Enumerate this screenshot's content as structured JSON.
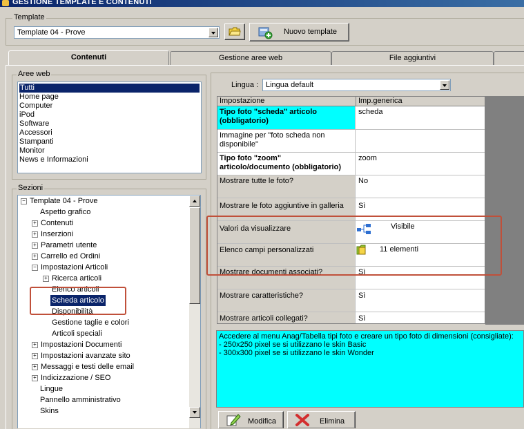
{
  "window": {
    "title": "GESTIONE TEMPLATE E CONTENUTI"
  },
  "template": {
    "group_label": "Template",
    "selected": "Template 04 - Prove",
    "new_button": "Nuovo template"
  },
  "tabs": [
    {
      "label": "Contenuti",
      "active": true
    },
    {
      "label": "Gestione aree web",
      "active": false
    },
    {
      "label": "File aggiuntivi",
      "active": false
    }
  ],
  "aree_web": {
    "label": "Aree web",
    "items": [
      "Tutti",
      "Home page",
      "Computer",
      "iPod",
      "Software",
      "Accessori",
      "Stampanti",
      "Monitor",
      "News e Informazioni"
    ],
    "selected_index": 0
  },
  "sezioni": {
    "label": "Sezioni",
    "nodes": [
      {
        "label": "Template 04 - Prove",
        "expander": "minus"
      },
      {
        "label": "Aspetto grafico",
        "expander": ""
      },
      {
        "label": "Contenuti",
        "expander": "plus"
      },
      {
        "label": "Inserzioni",
        "expander": "plus"
      },
      {
        "label": "Parametri utente",
        "expander": "plus"
      },
      {
        "label": "Carrello ed Ordini",
        "expander": "plus"
      },
      {
        "label": "Impostazioni Articoli",
        "expander": "minus"
      },
      {
        "label": "Ricerca articoli",
        "expander": "plus"
      },
      {
        "label": "Elenco articoli",
        "expander": ""
      },
      {
        "label": "Scheda articolo",
        "expander": ""
      },
      {
        "label": "Disponibilità",
        "expander": ""
      },
      {
        "label": "Gestione taglie e colori",
        "expander": ""
      },
      {
        "label": "Articoli speciali",
        "expander": ""
      },
      {
        "label": "Impostazioni Documenti",
        "expander": "plus"
      },
      {
        "label": "Impostazioni avanzate sito",
        "expander": "plus"
      },
      {
        "label": "Messaggi e testi delle email",
        "expander": "plus"
      },
      {
        "label": "Indicizzazione / SEO",
        "expander": "plus"
      },
      {
        "label": "Lingue",
        "expander": ""
      },
      {
        "label": "Pannello amministrativo",
        "expander": ""
      },
      {
        "label": "Skins",
        "expander": ""
      }
    ],
    "selected": "Scheda articolo"
  },
  "lingua": {
    "label": "Lingua :",
    "selected": "Lingua default"
  },
  "settings": {
    "headers": [
      "Impostazione",
      "Imp.generica"
    ],
    "rows": [
      {
        "name": "Tipo foto \"scheda\" articolo (obbligatorio)",
        "value": "scheda",
        "style": "hl"
      },
      {
        "name": "Immagine per \"foto scheda non disponibile\"",
        "value": "",
        "style": "white"
      },
      {
        "name": "Tipo foto \"zoom\" articolo/documento (obbligatorio)",
        "value": "zoom",
        "style": "bold"
      },
      {
        "name": "Mostrare tutte le foto?",
        "value": "No",
        "style": ""
      },
      {
        "name": "Mostrare le foto aggiuntive in galleria",
        "value": "Sì",
        "style": ""
      },
      {
        "name": "Valori da visualizzare",
        "value": "Visibile",
        "style": "",
        "icon": "tree-hierarchy-icon"
      },
      {
        "name": "Elenco campi personalizzati",
        "value": "11 elementi",
        "style": "",
        "icon": "folder-list-icon"
      },
      {
        "name": "Mostrare documenti associati?",
        "value": "Sì",
        "style": ""
      },
      {
        "name": "Mostrare caratteristiche?",
        "value": "Sì",
        "style": ""
      },
      {
        "name": "Mostrare articoli collegati?",
        "value": "Sì",
        "style": ""
      }
    ]
  },
  "info": {
    "lines": [
      "Accedere al menu Anag/Tabella tipi foto e creare un tipo foto di dimensioni (consigliate):",
      "- 250x250 pixel se si utilizzano le skin Basic",
      "- 300x300 pixel se si utilizzano le skin Wonder"
    ]
  },
  "actions": {
    "modify": "Modifica",
    "delete": "Elimina"
  },
  "colors": {
    "highlight": "#00ffff",
    "selection": "#0a246a",
    "annotation": "#c0503a"
  }
}
